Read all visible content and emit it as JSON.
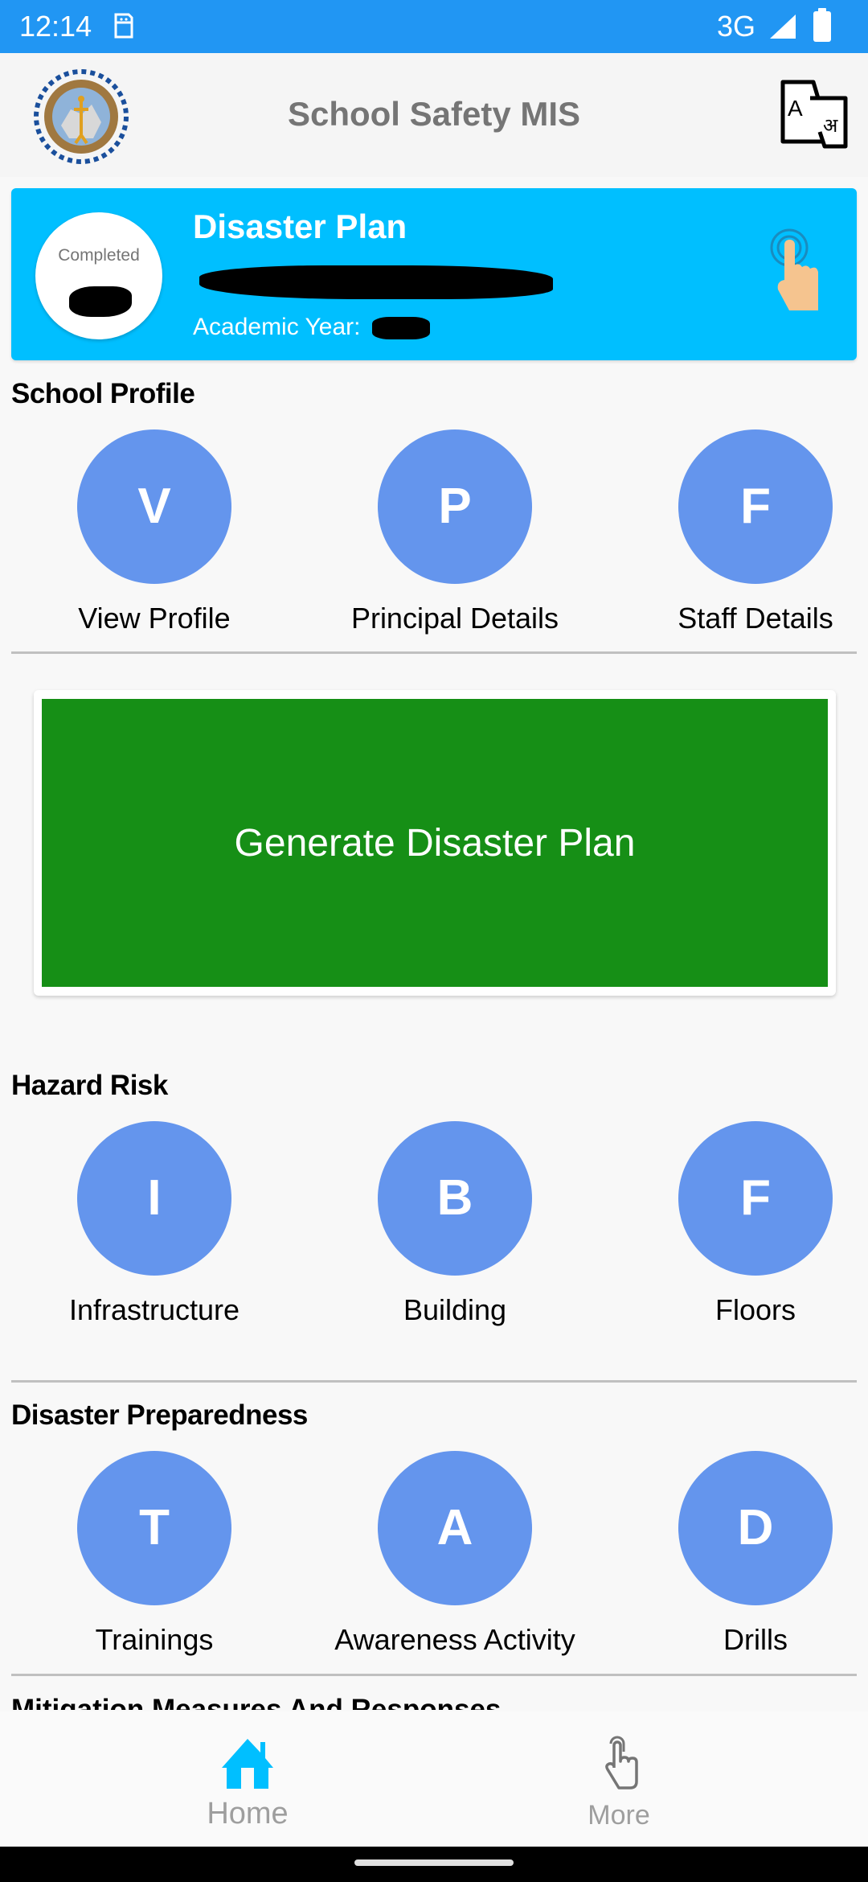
{
  "status_bar": {
    "time": "12:14",
    "network": "3G",
    "icons": [
      "sim-icon",
      "signal-icon",
      "battery-icon"
    ]
  },
  "app_bar": {
    "title": "School Safety MIS",
    "logo": "hpsdma-emblem-logo",
    "translate_icon": "translate-icon"
  },
  "plan_card": {
    "title": "Disaster Plan",
    "status": "Completed",
    "status_value": "[redacted]",
    "school_name": "[redacted]",
    "academic_year_label": "Academic Year:",
    "academic_year_value": "",
    "action_icon": "tap-hand-icon",
    "color": "#00bfff"
  },
  "sections": [
    {
      "title": "School Profile",
      "items": [
        {
          "letter": "V",
          "label": "View Profile"
        },
        {
          "letter": "P",
          "label": "Principal Details"
        },
        {
          "letter": "F",
          "label": "Staff Details"
        }
      ]
    },
    {
      "title": "Hazard Risk",
      "items": [
        {
          "letter": "I",
          "label": "Infrastructure"
        },
        {
          "letter": "B",
          "label": "Building"
        },
        {
          "letter": "F",
          "label": "Floors"
        }
      ]
    },
    {
      "title": "Disaster Preparedness",
      "items": [
        {
          "letter": "T",
          "label": "Trainings"
        },
        {
          "letter": "A",
          "label": "Awareness Activity"
        },
        {
          "letter": "D",
          "label": "Drills"
        }
      ]
    },
    {
      "title": "Mitigation Measures And Responses",
      "items": []
    }
  ],
  "generate_button": {
    "label": "Generate Disaster Plan",
    "color": "#168f16"
  },
  "tile_color": "#6495ed",
  "bottom_nav": {
    "items": [
      {
        "label": "Home",
        "icon": "home-icon",
        "active": true,
        "color": "#00bfff"
      },
      {
        "label": "More",
        "icon": "tap-hand-icon",
        "active": false,
        "color": "#757575"
      }
    ]
  }
}
